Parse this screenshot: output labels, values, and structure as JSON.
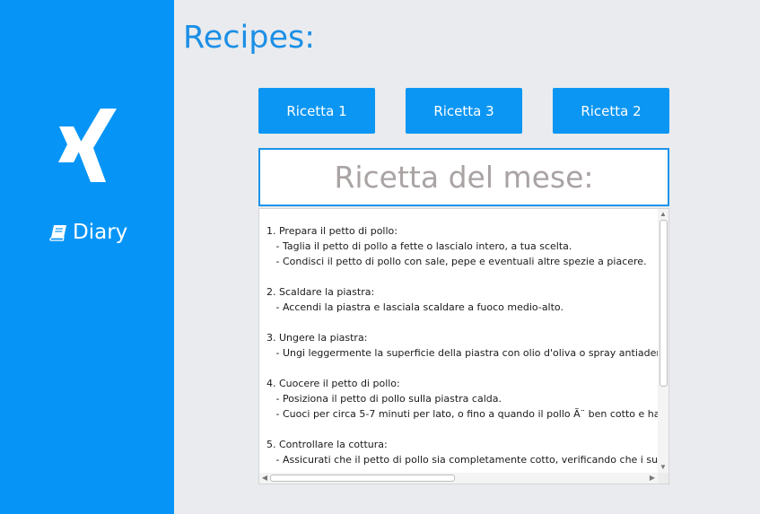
{
  "sidebar": {
    "logo_icon": "xing-logo-icon",
    "diary_icon": "book-icon",
    "diary_label": "Diary",
    "background": "#0695f6"
  },
  "main": {
    "title": "Recipes:",
    "buttons": [
      "Ricetta 1",
      "Ricetta 3",
      "Ricetta 2"
    ],
    "featured_label": "Ricetta del mese:",
    "recipe_text": "1. Prepara il petto di pollo:\n   - Taglia il petto di pollo a fette o lascialo intero, a tua scelta.\n   - Condisci il petto di pollo con sale, pepe e eventuali altre spezie a piacere.\n\n2. Scaldare la piastra:\n   - Accendi la piastra e lasciala scaldare a fuoco medio-alto.\n\n3. Ungere la piastra:\n   - Ungi leggermente la superficie della piastra con olio d'oliva o spray antiaderent\n\n4. Cuocere il petto di pollo:\n   - Posiziona il petto di pollo sulla piastra calda.\n   - Cuoci per circa 5-7 minuti per lato, o fino a quando il pollo Ã¨ ben cotto e ha o\n\n5. Controllare la cottura:\n   - Assicurati che il petto di pollo sia completamente cotto, verificando che i succh",
    "accent": "#0c96f3"
  }
}
